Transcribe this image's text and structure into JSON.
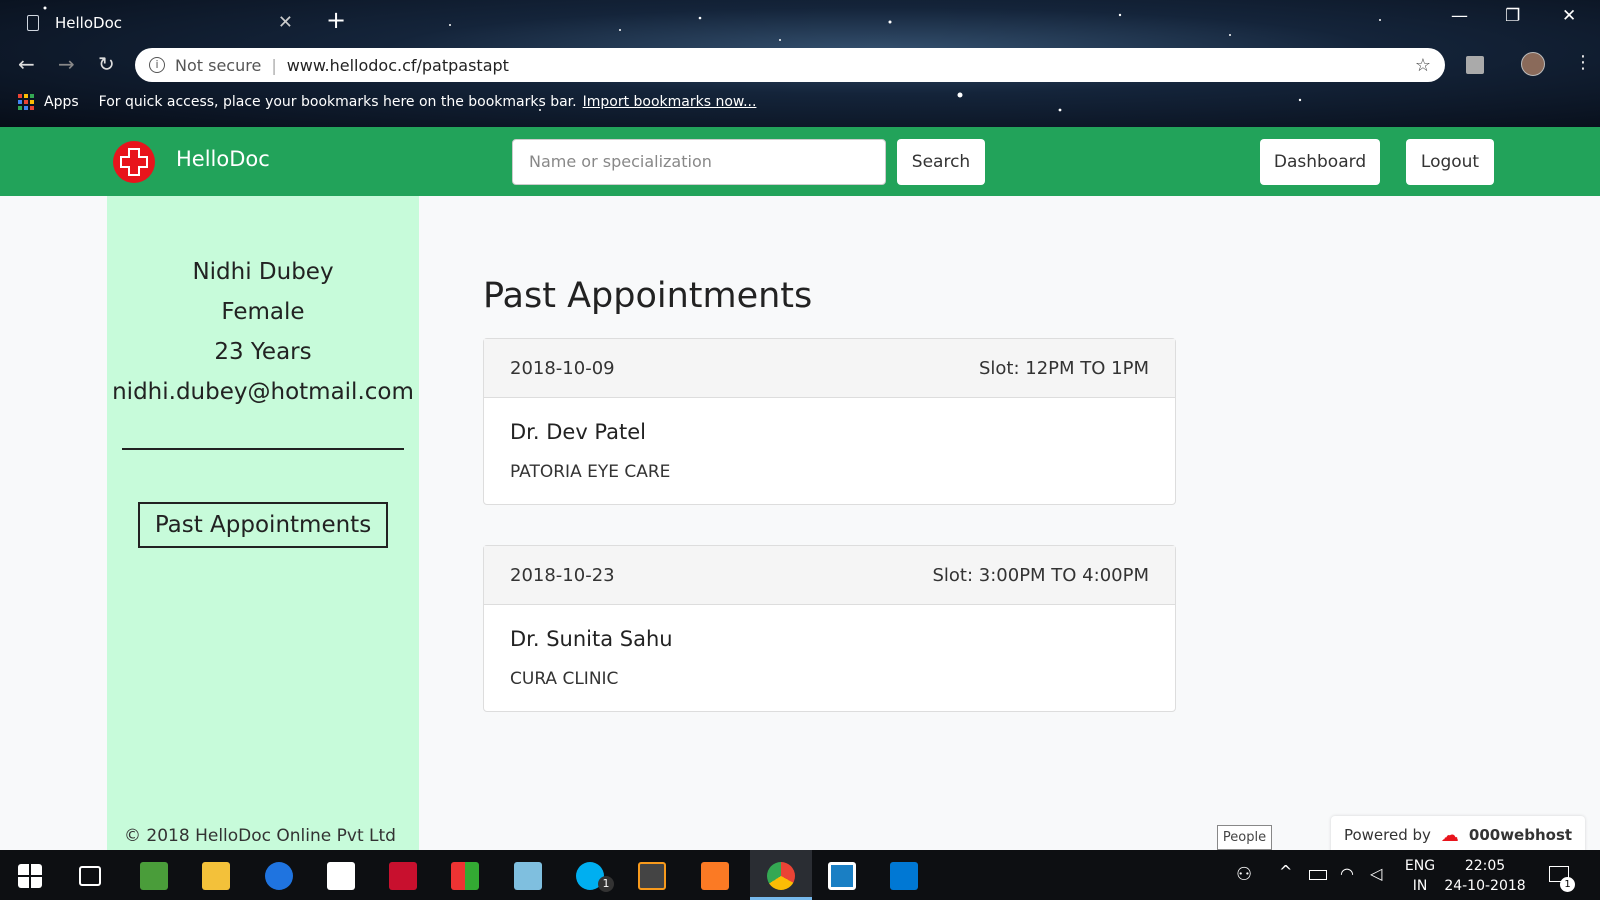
{
  "browser": {
    "tab_title": "HelloDoc",
    "tab_close": "✕",
    "new_tab": "+",
    "security_label": "Not secure",
    "url": "www.hellodoc.cf/patpastapt",
    "bookmarks_apps": "Apps",
    "bookmarks_message": "For quick access, place your bookmarks here on the bookmarks bar.",
    "bookmarks_import": "Import bookmarks now..."
  },
  "header": {
    "brand": "HelloDoc",
    "search_placeholder": "Name or specialization",
    "search_button": "Search",
    "dashboard_button": "Dashboard",
    "logout_button": "Logout",
    "accent_color": "#22a35a"
  },
  "sidebar": {
    "name": "Nidhi Dubey",
    "gender": "Female",
    "age": "23 Years",
    "email": "nidhi.dubey@hotmail.com",
    "nav_button": "Past Appointments",
    "copyright": "© 2018 HelloDoc Online Pvt Ltd",
    "background_color": "#c7fbda"
  },
  "main": {
    "title": "Past Appointments",
    "appointments": [
      {
        "date": "2018-10-09",
        "slot": "Slot: 12PM TO 1PM",
        "doctor": "Dr. Dev Patel",
        "clinic": "PATORIA EYE CARE"
      },
      {
        "date": "2018-10-23",
        "slot": "Slot: 3:00PM TO 4:00PM",
        "doctor": "Dr. Sunita Sahu",
        "clinic": "CURA CLINIC"
      }
    ]
  },
  "overlay": {
    "people_tooltip": "People",
    "powered_by": "Powered by",
    "host_brand": "000webhost"
  },
  "taskbar": {
    "language_top": "ENG",
    "language_bottom": "IN",
    "time": "22:05",
    "date": "24-10-2018",
    "skype_badge": "1",
    "notification_badge": "1",
    "icons": [
      "windows-start-icon",
      "task-view-icon",
      "photos-icon",
      "file-explorer-icon",
      "teamviewer-icon",
      "store-icon",
      "mcafee-icon",
      "winrar-icon",
      "notepad-icon",
      "skype-icon",
      "sublime-icon",
      "xampp-icon",
      "chrome-icon",
      "remote-icon",
      "vscode-icon"
    ]
  }
}
